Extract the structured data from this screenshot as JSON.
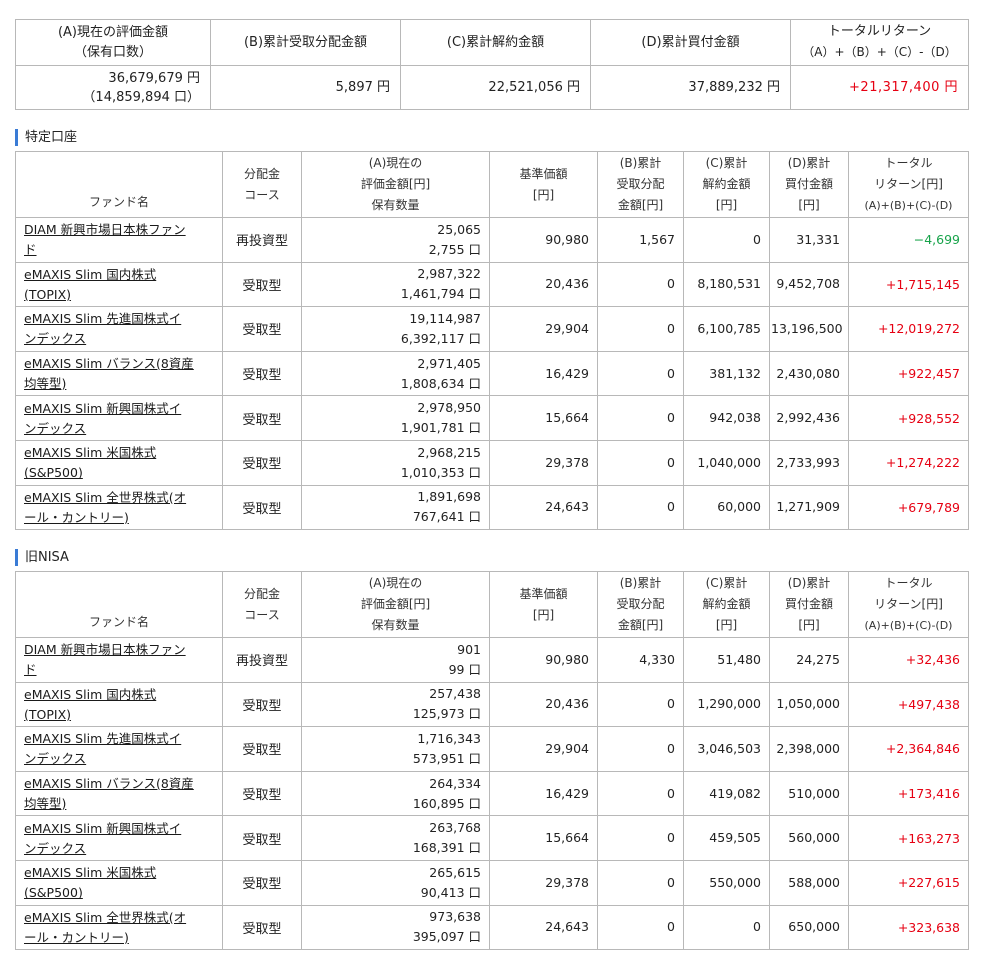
{
  "summary": {
    "headers": {
      "a_line1": "(A)現在の評価金額",
      "a_line2": "（保有口数）",
      "b": "(B)累計受取分配金額",
      "c": "(C)累計解約金額",
      "d": "(D)累計買付金額",
      "total_line1": "トータルリターン",
      "total_line2": "（A）+（B）+（C）-（D）"
    },
    "values": {
      "a_amount": "36,679,679 円",
      "a_units": "（14,859,894 口）",
      "b": "5,897 円",
      "c": "22,521,056 円",
      "d": "37,889,232 円",
      "total": "+21,317,400 円"
    }
  },
  "columns": {
    "fund_name": "ファンド名",
    "course_l1": "分配金",
    "course_l2": "コース",
    "a_l1": "(A)現在の",
    "a_l2": "評価金額[円]",
    "a_l3": "保有数量",
    "nav_l1": "基準価額",
    "nav_l2": "[円]",
    "b_l1": "(B)累計",
    "b_l2": "受取分配",
    "b_l3": "金額[円]",
    "c_l1": "(C)累計",
    "c_l2": "解約金額",
    "c_l3": "[円]",
    "d_l1": "(D)累計",
    "d_l2": "買付金額",
    "d_l3": "[円]",
    "ret_l1": "トータル",
    "ret_l2": "リターン[円]",
    "ret_l3": "(A)+(B)+(C)-(D)"
  },
  "sections": [
    {
      "title": "特定口座",
      "rows": [
        {
          "name1": "DIAM 新興市場日本株ファン",
          "name2": "ド",
          "course": "再投資型",
          "amount": "25,065",
          "units": "2,755 口",
          "nav": "90,980",
          "dist": "1,567",
          "sell": "0",
          "buy": "31,331",
          "ret": "−4,699",
          "neg": true
        },
        {
          "name1": "eMAXIS Slim 国内株式",
          "name2": "(TOPIX)",
          "course": "受取型",
          "amount": "2,987,322",
          "units": "1,461,794 口",
          "nav": "20,436",
          "dist": "0",
          "sell": "8,180,531",
          "buy": "9,452,708",
          "ret": "+1,715,145",
          "neg": false
        },
        {
          "name1": "eMAXIS Slim 先進国株式イ",
          "name2": "ンデックス",
          "course": "受取型",
          "amount": "19,114,987",
          "units": "6,392,117 口",
          "nav": "29,904",
          "dist": "0",
          "sell": "6,100,785",
          "buy": "13,196,500",
          "ret": "+12,019,272",
          "neg": false
        },
        {
          "name1": "eMAXIS Slim バランス(8資産",
          "name2": "均等型)",
          "course": "受取型",
          "amount": "2,971,405",
          "units": "1,808,634 口",
          "nav": "16,429",
          "dist": "0",
          "sell": "381,132",
          "buy": "2,430,080",
          "ret": "+922,457",
          "neg": false
        },
        {
          "name1": "eMAXIS Slim 新興国株式イ",
          "name2": "ンデックス",
          "course": "受取型",
          "amount": "2,978,950",
          "units": "1,901,781 口",
          "nav": "15,664",
          "dist": "0",
          "sell": "942,038",
          "buy": "2,992,436",
          "ret": "+928,552",
          "neg": false
        },
        {
          "name1": "eMAXIS Slim 米国株式",
          "name2": "(S&P500)",
          "course": "受取型",
          "amount": "2,968,215",
          "units": "1,010,353 口",
          "nav": "29,378",
          "dist": "0",
          "sell": "1,040,000",
          "buy": "2,733,993",
          "ret": "+1,274,222",
          "neg": false
        },
        {
          "name1": "eMAXIS Slim 全世界株式(オ",
          "name2": "ール・カントリー)",
          "course": "受取型",
          "amount": "1,891,698",
          "units": "767,641 口",
          "nav": "24,643",
          "dist": "0",
          "sell": "60,000",
          "buy": "1,271,909",
          "ret": "+679,789",
          "neg": false
        }
      ]
    },
    {
      "title": "旧NISA",
      "rows": [
        {
          "name1": "DIAM 新興市場日本株ファン",
          "name2": "ド",
          "course": "再投資型",
          "amount": "901",
          "units": "99 口",
          "nav": "90,980",
          "dist": "4,330",
          "sell": "51,480",
          "buy": "24,275",
          "ret": "+32,436",
          "neg": false
        },
        {
          "name1": "eMAXIS Slim 国内株式",
          "name2": "(TOPIX)",
          "course": "受取型",
          "amount": "257,438",
          "units": "125,973 口",
          "nav": "20,436",
          "dist": "0",
          "sell": "1,290,000",
          "buy": "1,050,000",
          "ret": "+497,438",
          "neg": false
        },
        {
          "name1": "eMAXIS Slim 先進国株式イ",
          "name2": "ンデックス",
          "course": "受取型",
          "amount": "1,716,343",
          "units": "573,951 口",
          "nav": "29,904",
          "dist": "0",
          "sell": "3,046,503",
          "buy": "2,398,000",
          "ret": "+2,364,846",
          "neg": false
        },
        {
          "name1": "eMAXIS Slim バランス(8資産",
          "name2": "均等型)",
          "course": "受取型",
          "amount": "264,334",
          "units": "160,895 口",
          "nav": "16,429",
          "dist": "0",
          "sell": "419,082",
          "buy": "510,000",
          "ret": "+173,416",
          "neg": false
        },
        {
          "name1": "eMAXIS Slim 新興国株式イ",
          "name2": "ンデックス",
          "course": "受取型",
          "amount": "263,768",
          "units": "168,391 口",
          "nav": "15,664",
          "dist": "0",
          "sell": "459,505",
          "buy": "560,000",
          "ret": "+163,273",
          "neg": false
        },
        {
          "name1": "eMAXIS Slim 米国株式",
          "name2": "(S&P500)",
          "course": "受取型",
          "amount": "265,615",
          "units": "90,413 口",
          "nav": "29,378",
          "dist": "0",
          "sell": "550,000",
          "buy": "588,000",
          "ret": "+227,615",
          "neg": false
        },
        {
          "name1": "eMAXIS Slim 全世界株式(オ",
          "name2": "ール・カントリー)",
          "course": "受取型",
          "amount": "973,638",
          "units": "395,097 口",
          "nav": "24,643",
          "dist": "0",
          "sell": "0",
          "buy": "650,000",
          "ret": "+323,638",
          "neg": false
        }
      ]
    }
  ],
  "colors": {
    "positive": "#e60012",
    "negative": "#17a34a",
    "accent": "#3a7bd5"
  }
}
